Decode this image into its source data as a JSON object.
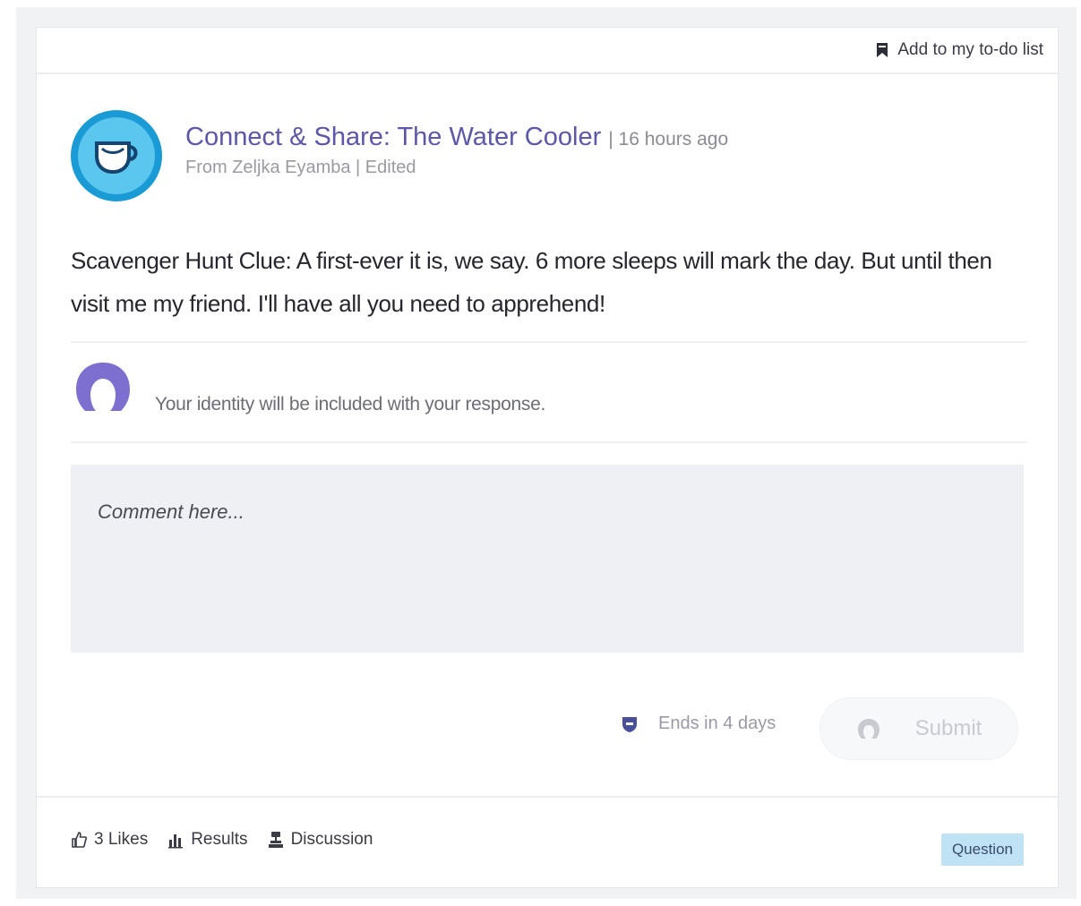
{
  "topbar": {
    "todo_label": "Add to my to-do list"
  },
  "post": {
    "group_name": "Connect & Share: The Water Cooler",
    "time_text": "| 16 hours ago",
    "from_text": "From Zeljka Eyamba | Edited",
    "body": "Scavenger Hunt Clue: A first-ever it is, we say. 6 more sleeps will mark the day. But until then visit me my friend. I'll have all you need to apprehend!"
  },
  "response": {
    "identity_notice": "Your identity will be included with your response.",
    "comment_placeholder": "Comment here...",
    "ends_text": "Ends in 4 days",
    "submit_label": "Submit"
  },
  "footer": {
    "likes_label": "3 Likes",
    "results_label": "Results",
    "discussion_label": "Discussion",
    "type_badge": "Question"
  },
  "colors": {
    "accent": "#5c57a8",
    "avatar_outer": "#1a9bd6",
    "avatar_inner": "#5bc6ee",
    "badge_bg": "#bfe3f5"
  },
  "icons": {
    "todo": "bookmark-icon",
    "group": "teacup-icon",
    "identity": "user-silhouette-icon",
    "ends": "shield-icon",
    "submit": "user-silhouette-icon",
    "likes": "thumbs-up-icon",
    "results": "bar-chart-icon",
    "discussion": "discussion-icon"
  }
}
